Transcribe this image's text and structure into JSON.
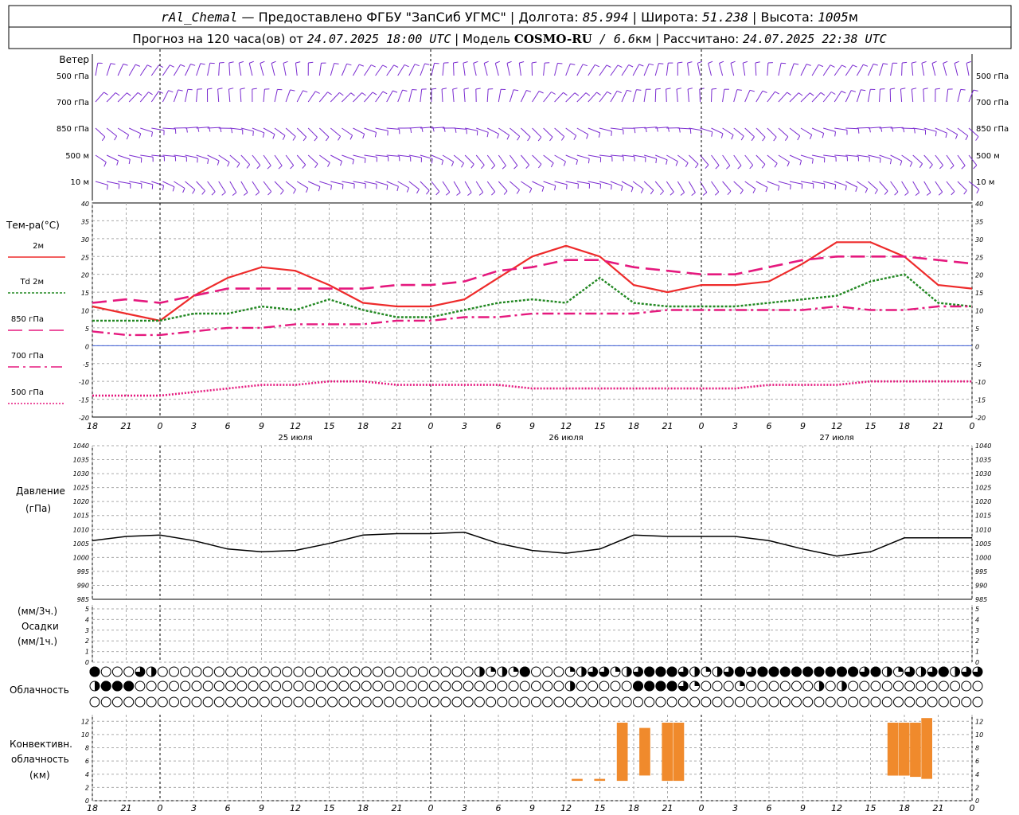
{
  "header": {
    "line1": {
      "station": "rAl_Chemal",
      "provider": " — Предоставлено ФГБУ \"ЗапСиб УГМС\" | Долгота: ",
      "lon": "85.994",
      "lat_label": " | Широта: ",
      "lat": "51.238",
      "alt_label": " | Высота: ",
      "alt": "1005",
      "alt_unit": "м"
    },
    "line2": {
      "forecast_label": "Прогноз на 120 часа(ов) от ",
      "init": "24.07.2025 18:00 UTC",
      "model_label": " | Модель ",
      "model": "COSMO-RU",
      "res": " / 6.6",
      "res_unit": "км",
      "calc_label": " | Рассчитано: ",
      "calc": "24.07.2025 22:38 UTC"
    }
  },
  "wind_panel": {
    "title": "Ветер",
    "levels": [
      "500 гПа",
      "700 гПа",
      "850 гПа",
      "500  м",
      "10  м"
    ]
  },
  "temp_panel": {
    "title": "Тем-ра(°C)",
    "legend": [
      {
        "label": "2м",
        "color": "#ee2b2b",
        "dash": "solid"
      },
      {
        "label": "Td  2м",
        "color": "#228822",
        "dash": "dot"
      },
      {
        "label": "850 гПа",
        "color": "#e5197e",
        "dash": "long"
      },
      {
        "label": "700 гПа",
        "color": "#e5197e",
        "dash": "dashdot"
      },
      {
        "label": "500 гПа",
        "color": "#e5197e",
        "dash": "fine"
      }
    ],
    "yticks": [
      "40",
      "35",
      "30",
      "25",
      "20",
      "15",
      "10",
      "5",
      "0",
      "-5",
      "-10",
      "-15",
      "-20"
    ]
  },
  "pressure_panel": {
    "title1": "Давление",
    "title2": "(гПа)",
    "yticks": [
      "1040",
      "1035",
      "1030",
      "1025",
      "1020",
      "1015",
      "1010",
      "1005",
      "1000",
      "995",
      "990",
      "985"
    ]
  },
  "precip_panel": {
    "label1": "(мм/3ч.)",
    "label2": "Осадки",
    "label3": "(мм/1ч.)",
    "yticks": [
      "5",
      "4",
      "3",
      "2",
      "1",
      "0"
    ]
  },
  "cloud_panel": {
    "title": "Облачность"
  },
  "conv_panel": {
    "title1": "Конвективн.",
    "title2": "облачность",
    "title3": "(км)",
    "yticks": [
      "12",
      "10",
      "8",
      "6",
      "4",
      "2",
      "0"
    ]
  },
  "time_axis": {
    "hour_labels": [
      "18",
      "21",
      "0",
      "3",
      "6",
      "9",
      "12",
      "15",
      "18",
      "21",
      "0",
      "3",
      "6",
      "9",
      "12",
      "15",
      "18",
      "21",
      "0",
      "3",
      "6",
      "9",
      "12",
      "15",
      "18",
      "21",
      "0"
    ],
    "day_labels": [
      "25 июля",
      "26 июля",
      "27 июля"
    ]
  },
  "chart_data": [
    {
      "type": "line",
      "title": "Тем-ра(°C)",
      "x_hours_from_init": [
        0,
        3,
        6,
        9,
        12,
        15,
        18,
        21,
        24,
        27,
        30,
        33,
        36,
        39,
        42,
        45,
        48,
        51,
        54,
        57,
        60,
        63,
        66,
        69,
        72,
        75,
        78
      ],
      "ylim": [
        -20,
        40
      ],
      "series": [
        {
          "name": "2м",
          "values": [
            11,
            9,
            7,
            14,
            19,
            22,
            21,
            17,
            12,
            11,
            11,
            13,
            19,
            25,
            28,
            25,
            17,
            15,
            17,
            17,
            18,
            23,
            29,
            29,
            25,
            17,
            16
          ],
          "color": "#ee2b2b"
        },
        {
          "name": "Td  2м",
          "values": [
            7,
            7,
            7,
            9,
            9,
            11,
            10,
            13,
            10,
            8,
            8,
            10,
            12,
            13,
            12,
            19,
            12,
            11,
            11,
            11,
            12,
            13,
            14,
            18,
            20,
            12,
            11
          ],
          "color": "#228822"
        },
        {
          "name": "850 гПа",
          "values": [
            12,
            13,
            12,
            14,
            16,
            16,
            16,
            16,
            16,
            17,
            17,
            18,
            21,
            22,
            24,
            24,
            22,
            21,
            20,
            20,
            22,
            24,
            25,
            25,
            25,
            24,
            23
          ],
          "color": "#e5197e"
        },
        {
          "name": "700 гПа",
          "values": [
            4,
            3,
            3,
            4,
            5,
            5,
            6,
            6,
            6,
            7,
            7,
            8,
            8,
            9,
            9,
            9,
            9,
            10,
            10,
            10,
            10,
            10,
            11,
            10,
            10,
            11,
            11
          ],
          "color": "#e5197e"
        },
        {
          "name": "500 гПа",
          "values": [
            -14,
            -14,
            -14,
            -13,
            -12,
            -11,
            -11,
            -10,
            -10,
            -11,
            -11,
            -11,
            -11,
            -12,
            -12,
            -12,
            -12,
            -12,
            -12,
            -12,
            -11,
            -11,
            -11,
            -10,
            -10,
            -10,
            -10
          ],
          "color": "#e5197e"
        }
      ]
    },
    {
      "type": "line",
      "title": "Давление (гПа)",
      "x_hours_from_init": [
        0,
        3,
        6,
        9,
        12,
        15,
        18,
        21,
        24,
        27,
        30,
        33,
        36,
        39,
        42,
        45,
        48,
        51,
        54,
        57,
        60,
        63,
        66,
        69,
        72,
        75,
        78
      ],
      "ylim": [
        985,
        1040
      ],
      "series": [
        {
          "name": "",
          "values": [
            1006,
            1007.5,
            1008,
            1006,
            1003,
            1002,
            1002.5,
            1005,
            1008,
            1008.5,
            1008.5,
            1009,
            1005,
            1002.5,
            1001.5,
            1003,
            1008,
            1007.5,
            1007.5,
            1007.5,
            1006,
            1003,
            1000.5,
            1002,
            1007,
            1007,
            1007
          ],
          "color": "#000000"
        }
      ]
    },
    {
      "type": "bar",
      "title": "Конвективн. облачность (км)",
      "ylim": [
        0,
        13
      ],
      "segments": [
        {
          "x_hour": 43,
          "base": 3.0,
          "top": 3.3
        },
        {
          "x_hour": 45,
          "base": 3.0,
          "top": 3.3
        },
        {
          "x_hour": 47,
          "base": 3.0,
          "top": 11.8
        },
        {
          "x_hour": 49,
          "base": 3.8,
          "top": 11.0
        },
        {
          "x_hour": 51,
          "base": 3.0,
          "top": 11.8
        },
        {
          "x_hour": 52,
          "base": 3.0,
          "top": 11.8
        },
        {
          "x_hour": 71,
          "base": 3.8,
          "top": 11.8
        },
        {
          "x_hour": 72,
          "base": 3.8,
          "top": 11.8
        },
        {
          "x_hour": 73,
          "base": 3.6,
          "top": 11.8
        },
        {
          "x_hour": 74,
          "base": 3.3,
          "top": 12.5
        }
      ],
      "color": "#f08a2c"
    }
  ]
}
